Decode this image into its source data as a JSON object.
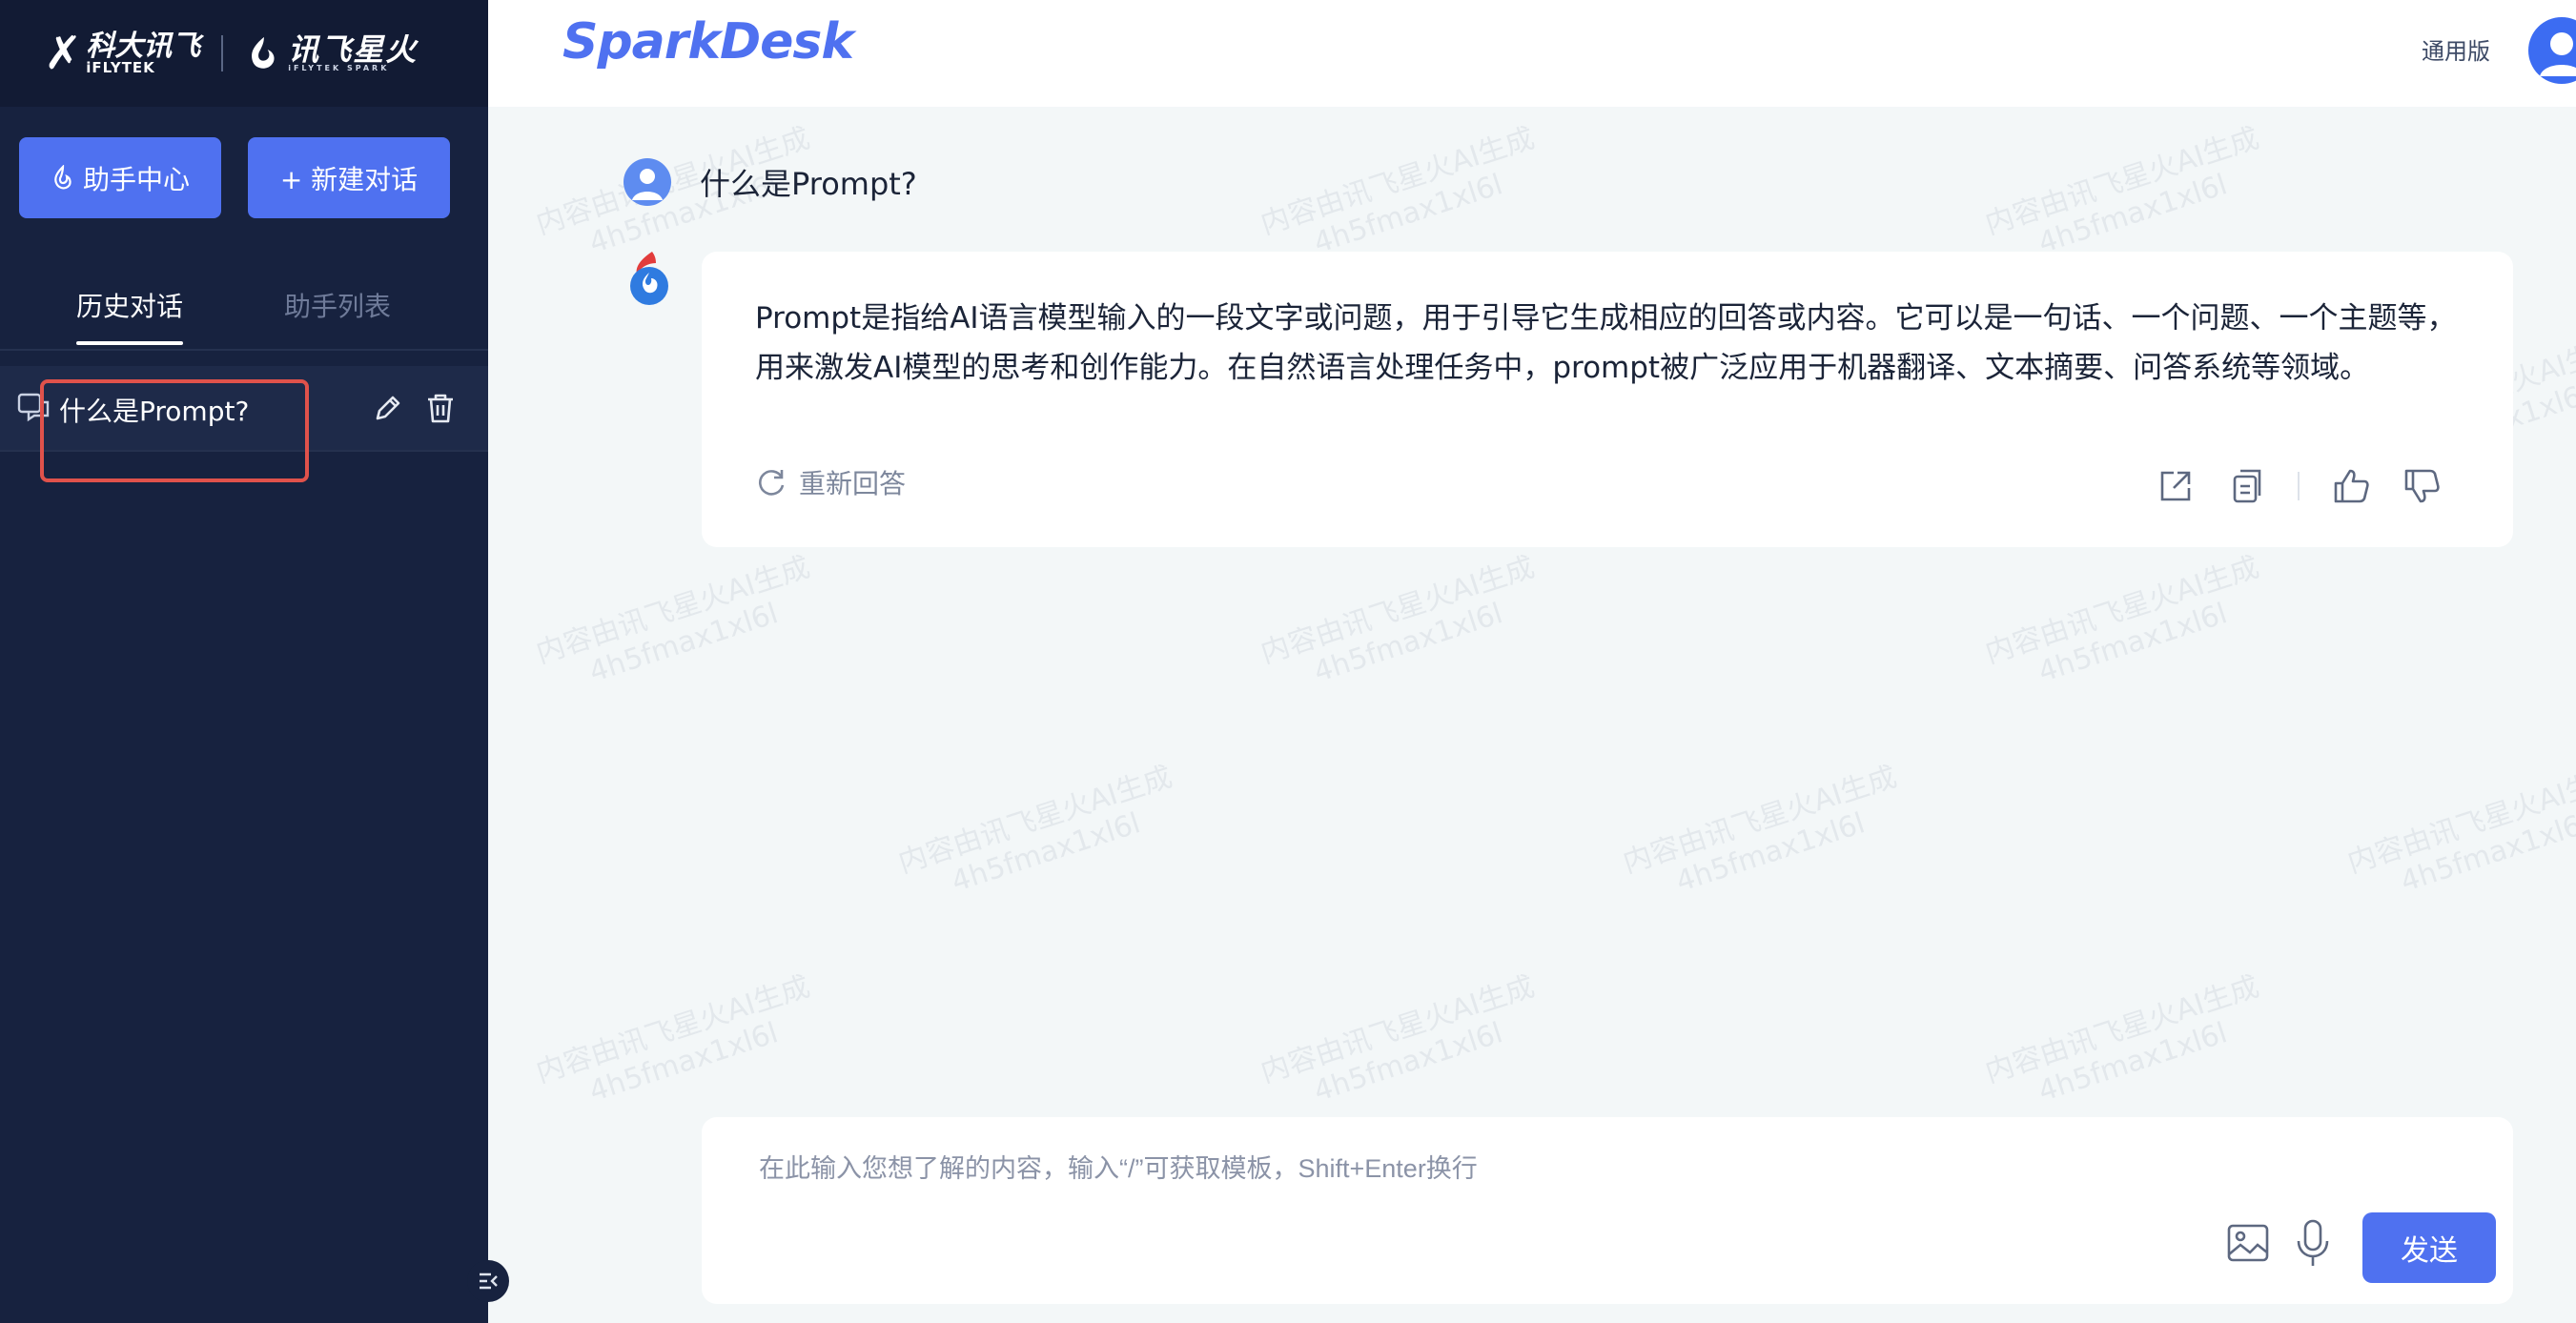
{
  "sidebar": {
    "logo_primary_cn": "科大讯飞",
    "logo_primary_en": "iFLYTEK",
    "logo_secondary_cn": "讯飞星火",
    "logo_secondary_en": "iFLYTEK SPARK",
    "assistant_center_label": "助手中心",
    "new_chat_label": "+ 新建对话",
    "tabs": [
      {
        "label": "历史对话",
        "active": true
      },
      {
        "label": "助手列表",
        "active": false
      }
    ],
    "history": [
      {
        "title": "什么是Prompt?"
      }
    ]
  },
  "header": {
    "app_logo": "SparkDesk",
    "edition": "通用版"
  },
  "chat": {
    "user_message": "什么是Prompt?",
    "bot_message": "Prompt是指给AI语言模型输入的一段文字或问题，用于引导它生成相应的回答或内容。它可以是一句话、一个问题、一个主题等，用来激发AI模型的思考和创作能力。在自然语言处理任务中，prompt被广泛应用于机器翻译、文本摘要、问答系统等领域。",
    "regenerate_label": "重新回答",
    "watermark_line1": "内容由讯飞星火AI生成",
    "watermark_line2": "4h5fmax1xl6l"
  },
  "input": {
    "placeholder": "在此输入您想了解的内容，输入“/”可获取模板，Shift+Enter换行",
    "value": "",
    "send_label": "发送"
  },
  "colors": {
    "sidebar_bg": "#17223f",
    "accent": "#4f71f0",
    "highlight": "#e0524b",
    "main_bg": "#f3f7f8"
  }
}
